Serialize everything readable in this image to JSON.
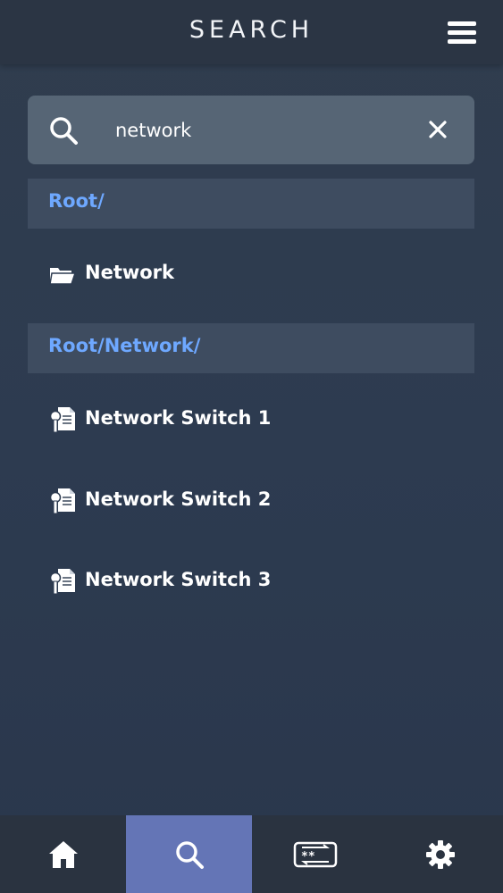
{
  "header": {
    "title": "SEARCH",
    "menu_icon": "hamburger-menu-icon"
  },
  "search": {
    "value": "network",
    "placeholder": "",
    "search_icon": "search-icon",
    "clear_icon": "close-icon"
  },
  "results": {
    "groups": [
      {
        "path": "Root/",
        "items": [
          {
            "label": "Network",
            "icon": "folder-open-icon"
          }
        ]
      },
      {
        "path": "Root/Network/",
        "items": [
          {
            "label": "Network Switch 1",
            "icon": "key-document-icon"
          },
          {
            "label": "Network Switch 2",
            "icon": "key-document-icon"
          },
          {
            "label": "Network Switch 3",
            "icon": "key-document-icon"
          }
        ]
      }
    ]
  },
  "bottom_nav": {
    "active": "search",
    "items": [
      {
        "name": "home",
        "icon": "home-icon"
      },
      {
        "name": "search",
        "icon": "search-icon"
      },
      {
        "name": "password-generator",
        "icon": "password-generator-icon"
      },
      {
        "name": "settings",
        "icon": "gear-icon"
      }
    ]
  },
  "colors": {
    "background": "#2e3b4e",
    "header": "#2b3544",
    "search_box": "#566575",
    "group_header": "#3e4c60",
    "path_text": "#6ea8ff",
    "nav_active": "#6475b6",
    "nav_bar": "#2a3340"
  }
}
